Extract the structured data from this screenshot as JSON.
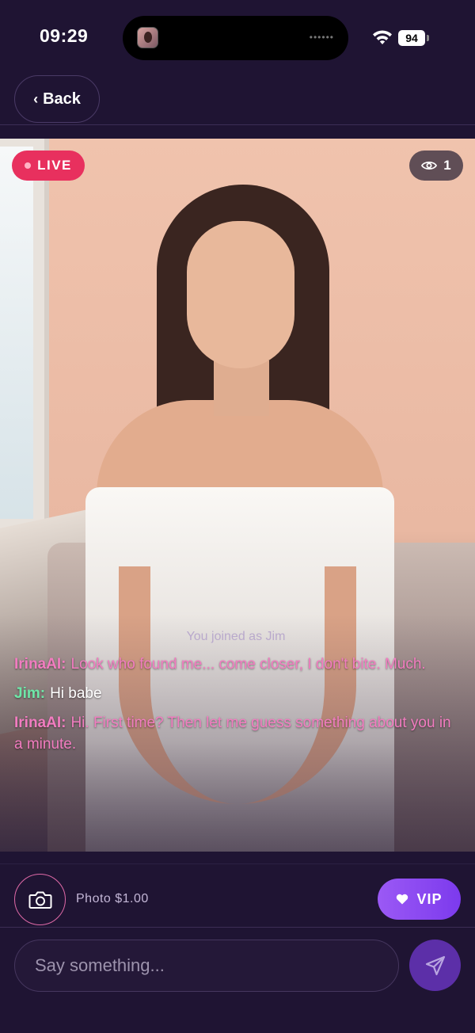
{
  "status_bar": {
    "time": "09:29",
    "island_indicator": "••••••",
    "battery": "94",
    "icons": [
      "app-avatar-icon",
      "wifi-icon",
      "battery-icon"
    ]
  },
  "header": {
    "back_label": "Back",
    "back_icon": "chevron-left-icon"
  },
  "stream": {
    "live_label": "LIVE",
    "viewer_count": "1",
    "viewer_icon": "eye-icon"
  },
  "chat": {
    "system_message": "You joined as Jim",
    "messages": [
      {
        "author": "IrinaAI:",
        "text": "Look who found me... come closer, I don't bite. Much."
      },
      {
        "author": "Jim:",
        "text": "Hi babe"
      },
      {
        "author": "IrinaAI:",
        "text": "Hi. First time? Then let me guess something about you in a minute."
      }
    ]
  },
  "actions": {
    "photo_label": "Photo $1.00",
    "photo_icon": "camera-icon",
    "vip_label": "VIP",
    "vip_icon": "heart-icon"
  },
  "composer": {
    "placeholder": "Say something...",
    "value": "",
    "send_icon": "send-icon"
  },
  "colors": {
    "background": "#1f1433",
    "live": "#e8305e",
    "irina": "#f27cc0",
    "jim": "#6ee7a8",
    "vip": "#8b45f0",
    "send": "#5c2fa8"
  }
}
